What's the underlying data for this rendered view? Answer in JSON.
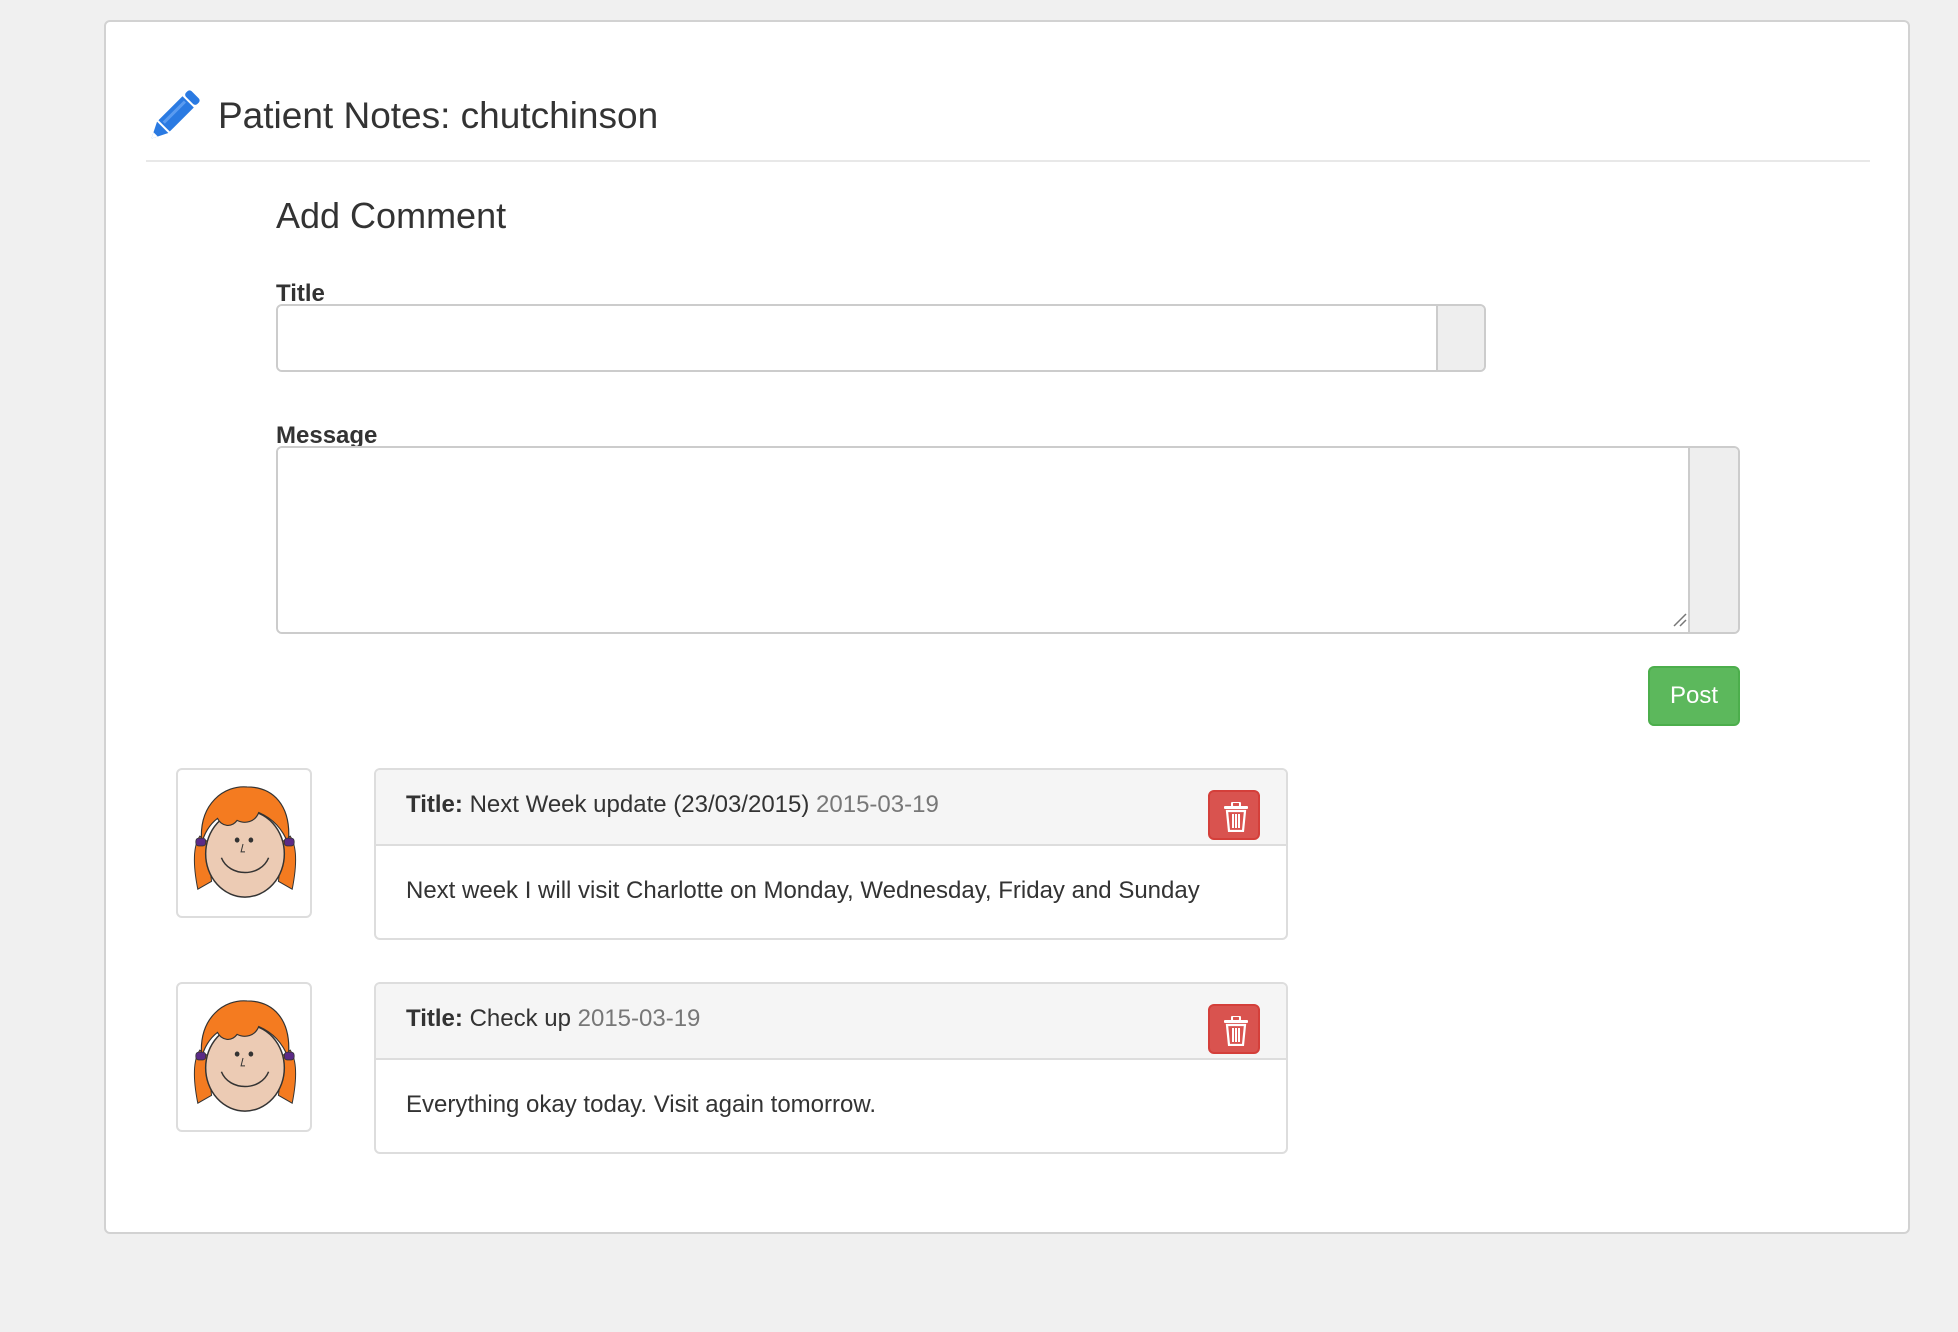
{
  "header": {
    "title": "Patient Notes: chutchinson",
    "icon": "pencil-icon",
    "icon_color": "#2a7ae2"
  },
  "form": {
    "heading": "Add Comment",
    "title_label": "Title",
    "title_value": "",
    "message_label": "Message",
    "message_value": "",
    "post_label": "Post",
    "post_color": "#5cb85c"
  },
  "comments": [
    {
      "title_prefix": "Title:",
      "title": "Next Week update (23/03/2015)",
      "date": "2015-03-19",
      "body": "Next week I will visit Charlotte on Monday, Wednesday, Friday and Sunday",
      "delete_icon": "trash-icon",
      "delete_color": "#d9534f"
    },
    {
      "title_prefix": "Title:",
      "title": "Check up",
      "date": "2015-03-19",
      "body": "Everything okay today. Visit again tomorrow.",
      "delete_icon": "trash-icon",
      "delete_color": "#d9534f"
    }
  ]
}
